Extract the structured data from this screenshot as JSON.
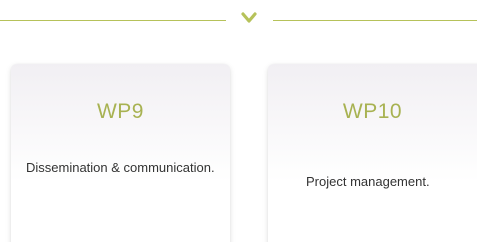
{
  "divider": {
    "icon": "chevron-down-icon",
    "color": "#b6c25a"
  },
  "work_packages": [
    {
      "title": "WP9",
      "description": "Dissemination & communication."
    },
    {
      "title": "WP10",
      "description": "Project management."
    }
  ],
  "colors": {
    "title": "#a8b252",
    "text": "#333333",
    "card_top": "#f1eff3"
  }
}
